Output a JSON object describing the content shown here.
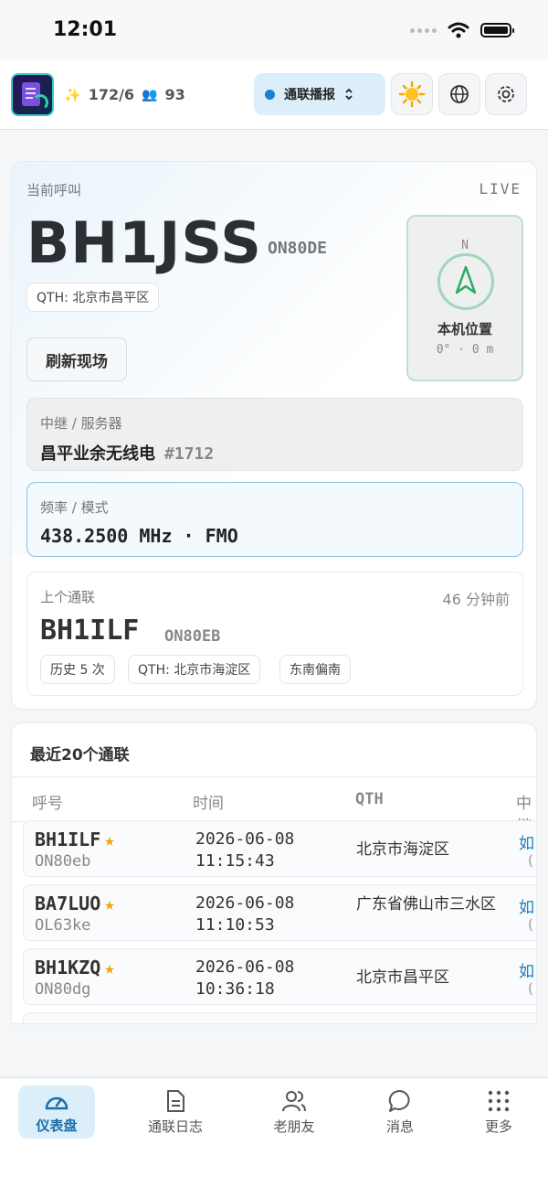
{
  "status_bar": {
    "time": "12:01"
  },
  "header": {
    "stats": {
      "primary": "172/6",
      "secondary": "93"
    },
    "mode_pill": {
      "label": "通联播报"
    }
  },
  "current": {
    "label": "当前呼叫",
    "live": "LIVE",
    "callsign": "BH1JSS",
    "grid": "ON80DE",
    "qth": "QTH: 北京市昌平区",
    "refresh_label": "刷新现场",
    "compass": {
      "north": "N",
      "title": "本机位置",
      "value": "0° · 0 m"
    },
    "repeater": {
      "label": "中继 / 服务器",
      "name": "昌平业余无线电",
      "number": "#1712"
    },
    "frequency": {
      "label": "频率 / 模式",
      "value": "438.2500 MHz · FMO"
    },
    "previous": {
      "label": "上个通联",
      "ago": "46 分钟前",
      "callsign": "BH1ILF",
      "grid": "ON80EB",
      "chips": [
        "历史 5 次",
        "QTH: 北京市海淀区",
        "东南偏南"
      ]
    }
  },
  "recent": {
    "title": "最近20个通联",
    "columns": [
      "呼号",
      "时间",
      "QTH",
      "中继"
    ],
    "rows": [
      {
        "callsign": "BH1ILF",
        "grid": "ON80eb",
        "date": "2026-06-08",
        "time": "11:15:43",
        "qth": "北京市海淀区",
        "repeater": "如",
        "repeater_sub": "("
      },
      {
        "callsign": "BA7LUO",
        "grid": "OL63ke",
        "date": "2026-06-08",
        "time": "11:10:53",
        "qth": "广东省佛山市三水区",
        "repeater": "如",
        "repeater_sub": "("
      },
      {
        "callsign": "BH1KZQ",
        "grid": "ON80dg",
        "date": "2026-06-08",
        "time": "10:36:18",
        "qth": "北京市昌平区",
        "repeater": "如",
        "repeater_sub": "("
      }
    ]
  },
  "bottom_nav": [
    {
      "label": "仪表盘",
      "icon": "dashboard-icon",
      "active": true
    },
    {
      "label": "通联日志",
      "icon": "log-icon",
      "active": false
    },
    {
      "label": "老朋友",
      "icon": "friends-icon",
      "active": false
    },
    {
      "label": "消息",
      "icon": "message-icon",
      "active": false
    },
    {
      "label": "更多",
      "icon": "more-icon",
      "active": false
    }
  ],
  "colors": {
    "accent": "#1a7fd1",
    "star": "#f2a400",
    "compass": "#2fa86a",
    "nav_active_bg": "#dceef9"
  }
}
